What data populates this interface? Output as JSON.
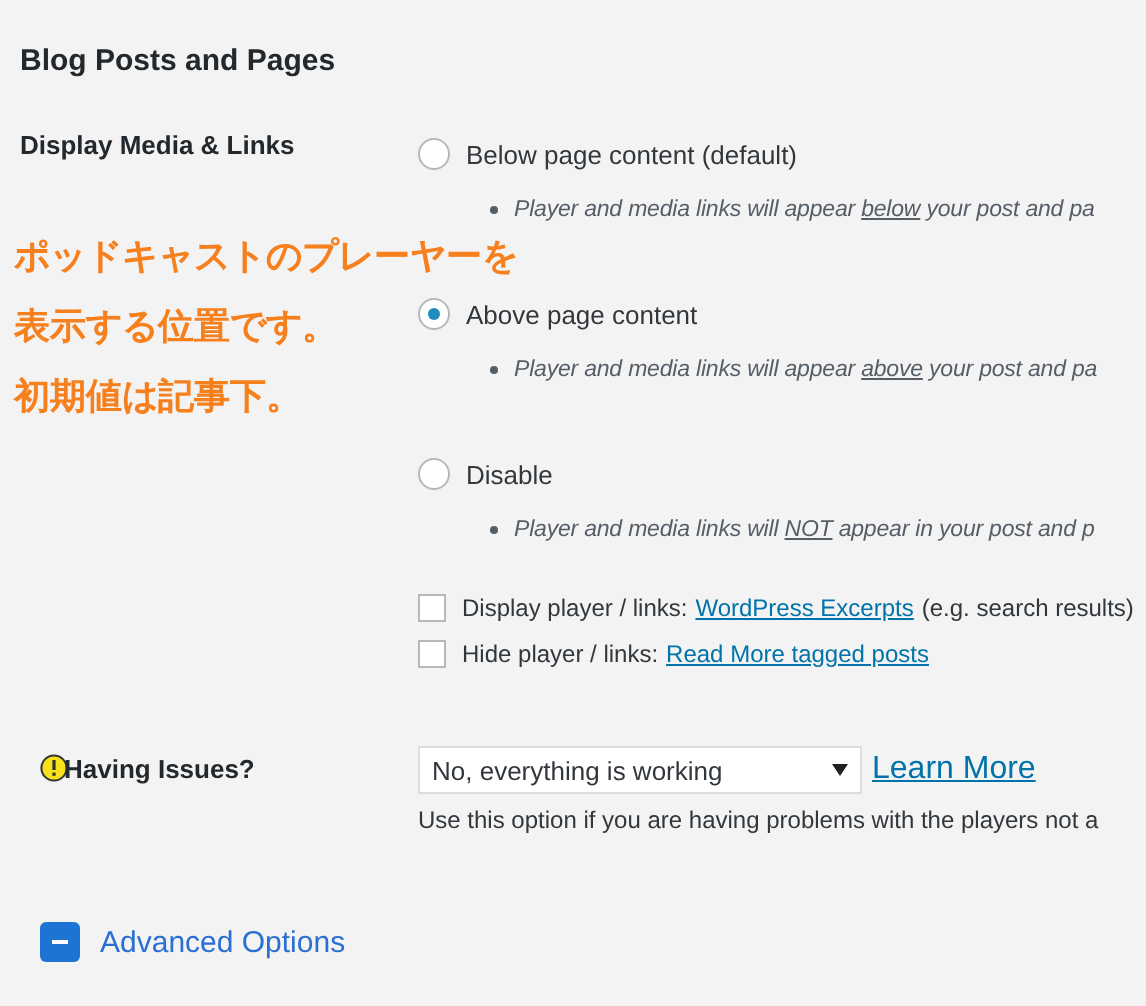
{
  "section_title": "Blog Posts and Pages",
  "display_setting": {
    "label": "Display Media & Links",
    "radios": [
      {
        "label": "Below page content",
        "suffix": "(default)",
        "selected": false,
        "note_before": "Player and media links will appear ",
        "note_emphasis": "below",
        "note_after": " your post and pa"
      },
      {
        "label": "Above page content",
        "selected": true,
        "note_before": "Player and media links will appear ",
        "note_emphasis": "above",
        "note_after": " your post and pa"
      },
      {
        "label": "Disable",
        "selected": false,
        "note_before": "Player and media links will ",
        "note_emphasis": "NOT",
        "note_after": " appear in your post and p"
      }
    ],
    "checkboxes": [
      {
        "label": "Display player / links:",
        "link": "WordPress Excerpts",
        "suffix": "(e.g. search results)",
        "checked": false
      },
      {
        "label": "Hide player / links:",
        "link": "Read More tagged posts",
        "checked": false
      }
    ]
  },
  "issues": {
    "label": "Having Issues?",
    "select_value": "No, everything is working",
    "link": "Learn More",
    "help": "Use this option if you are having problems with the players not a"
  },
  "advanced": {
    "label": "Advanced Options",
    "expanded": true
  },
  "annotation": [
    "ポッドキャストのプレーヤーを",
    "表示する位置です。",
    "初期値は記事下。"
  ]
}
